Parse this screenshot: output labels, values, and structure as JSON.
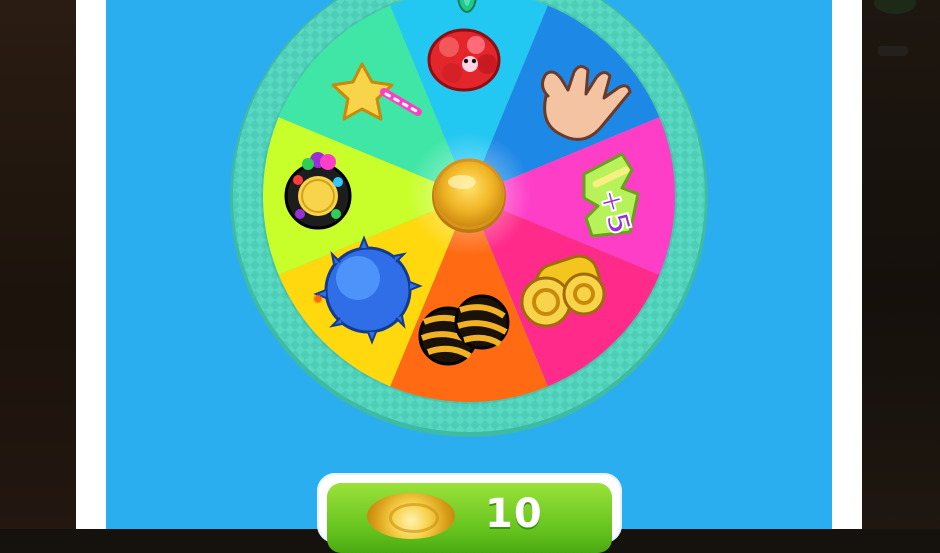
{
  "screen": {
    "name": "prize-wheel"
  },
  "wheel": {
    "segments": [
      {
        "prize": "jelly-cluster",
        "color": "#22c7f2"
      },
      {
        "prize": "hand-icon",
        "color": "#1e88e6"
      },
      {
        "prize": "+5",
        "color": "#ff3ec8"
      },
      {
        "prize": "swirl-candy",
        "color": "#ff2a8a"
      },
      {
        "prize": "striped-candy",
        "color": "#ff6a12"
      },
      {
        "prize": "spiky-ball",
        "color": "#ffd80e"
      },
      {
        "prize": "color-bomb",
        "color": "#c8ff2a"
      },
      {
        "prize": "star-wand",
        "color": "#3fe6a6"
      }
    ],
    "bonus_label": "+5",
    "hub_color": "#f6c52f",
    "rim_color": "#59d9c2"
  },
  "spin_button": {
    "cost": "10",
    "currency_icon": "gold-coin-icon"
  },
  "colors": {
    "stage_background": "#2aaef0",
    "panel_background": "#ffffff"
  }
}
